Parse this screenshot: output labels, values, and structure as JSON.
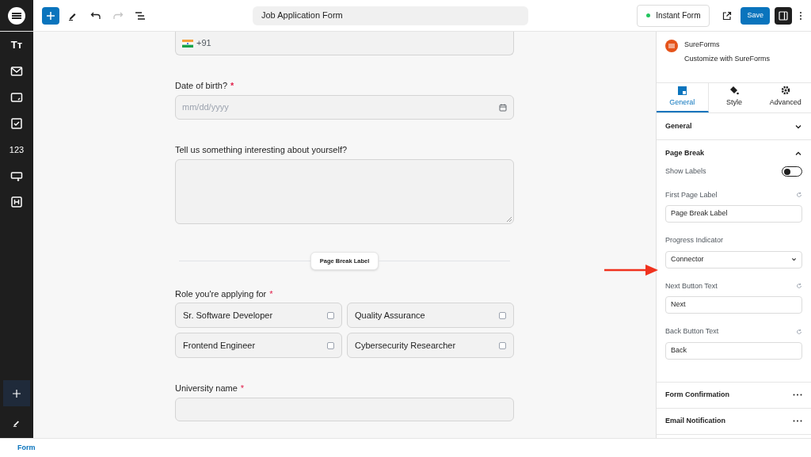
{
  "toolbar": {
    "document_title": "Job Application Form",
    "status_button": "Instant Form",
    "save_button": "Save",
    "settings_panel_open": true
  },
  "sidebar": {
    "type_label": "Tт",
    "number_label": "123"
  },
  "form": {
    "phone": {
      "prefix": "+91"
    },
    "date_field": {
      "label": "Date of birth?",
      "required_mark": "*",
      "placeholder": "mm/dd/yyyy"
    },
    "textarea_field": {
      "label": "Tell us something interesting about yourself?"
    },
    "page_break": {
      "label": "Page Break Label"
    },
    "role_field": {
      "label": "Role you're applying for",
      "required_mark": "*",
      "options": [
        {
          "label": "Sr. Software Developer",
          "checked": false
        },
        {
          "label": "Quality Assurance",
          "checked": false
        },
        {
          "label": "Frontend Engineer",
          "checked": false
        },
        {
          "label": "Cybersecurity Researcher",
          "checked": false
        }
      ]
    },
    "university_field": {
      "label": "University name",
      "required_mark": "*"
    }
  },
  "panel": {
    "brand": {
      "name": "SureForms",
      "subtitle": "Customize with SureForms"
    },
    "tabs": [
      {
        "label": "General",
        "selected": true
      },
      {
        "label": "Style",
        "selected": false
      },
      {
        "label": "Advanced",
        "selected": false
      }
    ],
    "sections": [
      {
        "kind": "collapsible",
        "title": "General",
        "expanded": false
      },
      {
        "kind": "collapsible",
        "title": "Page Break",
        "expanded": true,
        "settings": [
          {
            "kind": "toggle",
            "label": "Show Labels",
            "on": false
          },
          {
            "kind": "text",
            "label": "First Page Label",
            "value": "Page Break Label"
          },
          {
            "kind": "select",
            "label": "Progress Indicator",
            "value": "Connector"
          },
          {
            "kind": "text",
            "label": "Next Button Text",
            "value": "Next"
          },
          {
            "kind": "text",
            "label": "Back Button Text",
            "value": "Back"
          }
        ]
      },
      {
        "kind": "menu",
        "title": "Form Confirmation"
      },
      {
        "kind": "menu",
        "title": "Email Notification"
      }
    ]
  },
  "footer": {
    "breadcrumb": "Form"
  }
}
